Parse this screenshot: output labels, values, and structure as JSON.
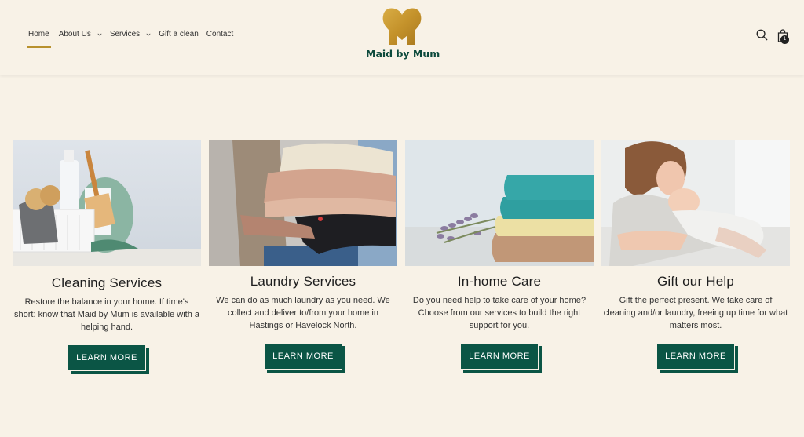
{
  "brand": {
    "name": "Maid by Mum",
    "logo_color": "#c99a2e",
    "text_color": "#0c4a3c"
  },
  "nav": {
    "items": [
      {
        "label": "Home",
        "active": true,
        "dropdown": false
      },
      {
        "label": "About Us",
        "active": false,
        "dropdown": true
      },
      {
        "label": "Services",
        "active": false,
        "dropdown": true
      },
      {
        "label": "Gift a clean",
        "active": false,
        "dropdown": false
      },
      {
        "label": "Contact",
        "active": false,
        "dropdown": false
      }
    ]
  },
  "header_actions": {
    "search_icon": "search-icon",
    "cart_icon": "shopping-bag-icon",
    "cart_count": "1"
  },
  "cards": [
    {
      "title": "Cleaning Services",
      "description": "Restore the balance in your home. If time's short: know that Maid by Mum is available with a helping hand.",
      "button": "LEARN MORE"
    },
    {
      "title": "Laundry Services",
      "description": "We can do as much laundry as you need. We collect and deliver to/from your home in Hastings or Havelock North.",
      "button": "LEARN MORE"
    },
    {
      "title": "In-home Care",
      "description": "Do you need help to take care of your home? Choose from our services to build the right support for you.",
      "button": "LEARN MORE"
    },
    {
      "title": "Gift our Help",
      "description": "Gift the perfect present. We take care of cleaning and/or laundry, freeing up time for what matters most.",
      "button": "LEARN MORE"
    }
  ],
  "colors": {
    "background": "#f8f2e7",
    "button": "#0b5545",
    "accent": "#b8912e"
  }
}
